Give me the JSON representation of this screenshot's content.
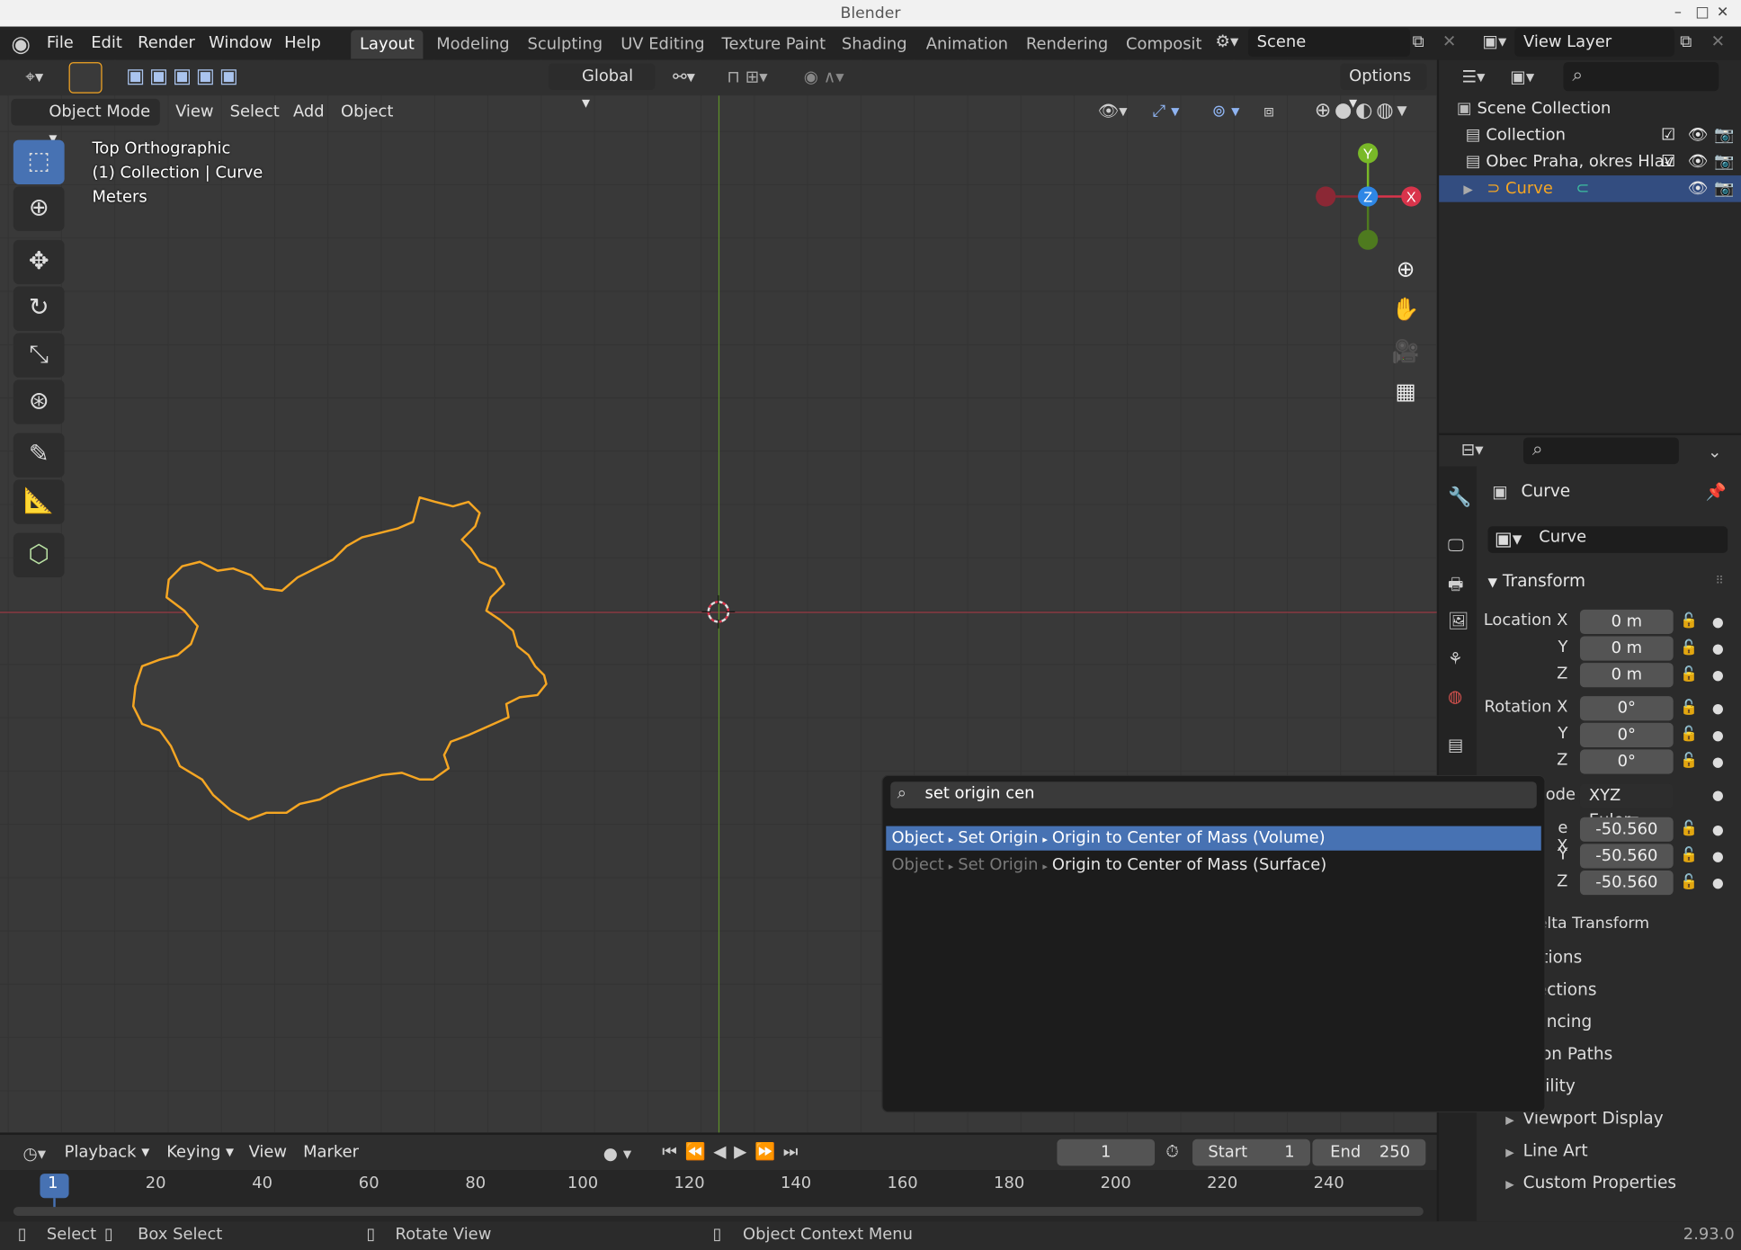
{
  "window": {
    "title": "Blender",
    "controls": [
      "–",
      "□",
      "✕"
    ]
  },
  "menu": [
    "File",
    "Edit",
    "Render",
    "Window",
    "Help"
  ],
  "workspaces": [
    {
      "label": "Layout",
      "active": true
    },
    {
      "label": "Modeling"
    },
    {
      "label": "Sculpting"
    },
    {
      "label": "UV Editing"
    },
    {
      "label": "Texture Paint"
    },
    {
      "label": "Shading"
    },
    {
      "label": "Animation"
    },
    {
      "label": "Rendering"
    },
    {
      "label": "Composit"
    }
  ],
  "scene_field": "Scene",
  "view_layer_field": "View Layer",
  "viewport": {
    "transform_orientation": "Global",
    "options_label": "Options",
    "mode": "Object Mode",
    "menus": [
      "View",
      "Select",
      "Add",
      "Object"
    ],
    "overlay_lines": [
      "Top Orthographic",
      "(1) Collection | Curve",
      "Meters"
    ],
    "gizmo_axes": {
      "y": "Y",
      "z": "Z",
      "x": "X"
    }
  },
  "outliner": {
    "root": "Scene Collection",
    "items": [
      {
        "label": "Collection"
      },
      {
        "label": "Obec Praha, okres Hlav"
      },
      {
        "label": "Curve",
        "selected": true
      }
    ]
  },
  "properties": {
    "object_name": "Curve",
    "data_name": "Curve",
    "section": "Transform",
    "location": {
      "label": "Location X",
      "x": "0 m",
      "y": "0 m",
      "z": "0 m"
    },
    "rotation": {
      "label": "Rotation X",
      "x": "0°",
      "y": "0°",
      "z": "0°"
    },
    "mode_label": "ode",
    "rotation_mode": "XYZ Euler",
    "scale": {
      "label": "e X",
      "x": "-50.560",
      "y": "-50.560",
      "z": "-50.560"
    },
    "axis_labels": {
      "y": "Y",
      "z": "Z"
    },
    "subpanels": [
      "Delta Transform",
      "Relations",
      "Collections",
      "Instancing",
      "Motion Paths",
      "Visibility",
      "Viewport Display",
      "Line Art",
      "Custom Properties"
    ]
  },
  "search_popup": {
    "query": "set origin cen",
    "results": [
      {
        "path": [
          "Object",
          "Set Origin"
        ],
        "label": "Origin to Center of Mass (Volume)",
        "selected": true
      },
      {
        "path": [
          "Object",
          "Set Origin"
        ],
        "label": "Origin to Center of Mass (Surface)"
      }
    ]
  },
  "timeline": {
    "menus": [
      "Playback",
      "Keying",
      "View",
      "Marker"
    ],
    "current_frame": "1",
    "start_label": "Start",
    "start": "1",
    "end_label": "End",
    "end": "250",
    "ruler": [
      "1",
      "20",
      "40",
      "60",
      "80",
      "100",
      "120",
      "140",
      "160",
      "180",
      "200",
      "220",
      "240"
    ]
  },
  "statusbar": {
    "select": "Select",
    "box_select": "Box Select",
    "rotate_view": "Rotate View",
    "context_menu": "Object Context Menu",
    "version": "2.93.0"
  },
  "colors": {
    "accent": "#4772b3",
    "selection": "#f5a623",
    "x_axis": "#d9344b",
    "y_axis": "#79b928",
    "z_axis": "#2e87e6"
  }
}
